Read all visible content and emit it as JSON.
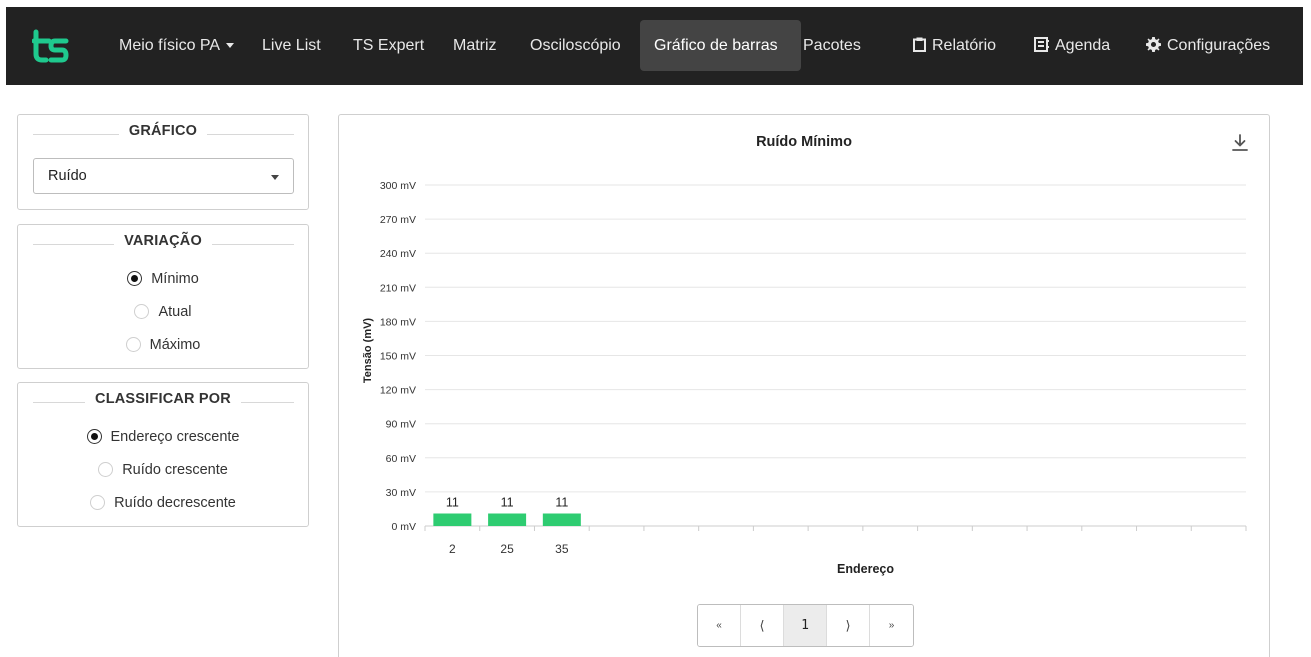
{
  "navbar": {
    "logo_text": "ts",
    "items": [
      {
        "label": "Meio físico PA",
        "dropdown": true
      },
      {
        "label": "Live List"
      },
      {
        "label": "TS Expert"
      },
      {
        "label": "Matriz"
      },
      {
        "label": "Osciloscópio"
      },
      {
        "label": "Gráfico de barras",
        "active": true
      },
      {
        "label": "Pacotes"
      },
      {
        "label": "Relatório",
        "icon": "clipboard-icon"
      },
      {
        "label": "Agenda",
        "icon": "contact-card-icon"
      },
      {
        "label": "Configurações",
        "icon": "gear-icon"
      }
    ]
  },
  "colors": {
    "navbar_bg": "#222222",
    "logo_accent": "#1fc98e",
    "bar": "#2ecc71"
  },
  "sidebar": {
    "grafico": {
      "title": "GRÁFICO",
      "selected": "Ruído"
    },
    "variacao": {
      "title": "VARIAÇÃO",
      "options": [
        "Mínimo",
        "Atual",
        "Máximo"
      ],
      "selected_index": 0
    },
    "classificar": {
      "title": "CLASSIFICAR POR",
      "options": [
        "Endereço crescente",
        "Ruído crescente",
        "Ruído decrescente"
      ],
      "selected_index": 0
    }
  },
  "chart_data": {
    "type": "bar",
    "title": "Ruído Mínimo",
    "xlabel": "Endereço",
    "ylabel": "Tensão (mV)",
    "y_unit": "mV",
    "ylim": [
      0,
      300
    ],
    "yticks": [
      0,
      30,
      60,
      90,
      120,
      150,
      180,
      210,
      240,
      270,
      300
    ],
    "categories": [
      "2",
      "25",
      "35"
    ],
    "values": [
      11,
      11,
      11
    ],
    "grid": true,
    "legend": "none"
  },
  "pagination": {
    "first": "«",
    "prev": "⟨",
    "current": "1",
    "next": "⟩",
    "last": "»"
  }
}
